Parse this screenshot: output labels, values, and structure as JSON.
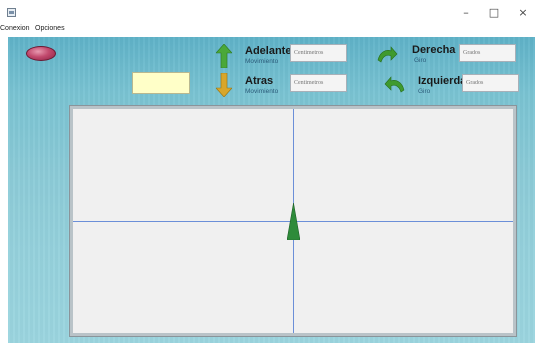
{
  "window": {
    "minimize_glyph": "–",
    "maximize_glyph": "□",
    "close_glyph": "×"
  },
  "menu": {
    "items": [
      "Conexion",
      "Opciones"
    ]
  },
  "controls": {
    "forward": {
      "label": "Adelante",
      "sublabel": "Movimiento",
      "placeholder": "Centimetros"
    },
    "backward": {
      "label": "Atras",
      "sublabel": "Movimiento",
      "placeholder": "Centimetros"
    },
    "right": {
      "label": "Derecha",
      "sublabel": "Giro",
      "placeholder": "Grados"
    },
    "left": {
      "label": "Izquierda",
      "sublabel": "Giro",
      "placeholder": "Grados"
    }
  },
  "icons": {
    "forward": "arrow-up-icon",
    "backward": "arrow-down-icon",
    "right": "turn-right-icon",
    "left": "turn-left-icon",
    "connection": "connection-status-icon",
    "robot": "robot-icon"
  },
  "colors": {
    "accent_green": "#3f9a2e",
    "axis_blue": "#6b8fd8",
    "connection_led": "#c24a6e",
    "background_teal": "#79c3d2"
  }
}
